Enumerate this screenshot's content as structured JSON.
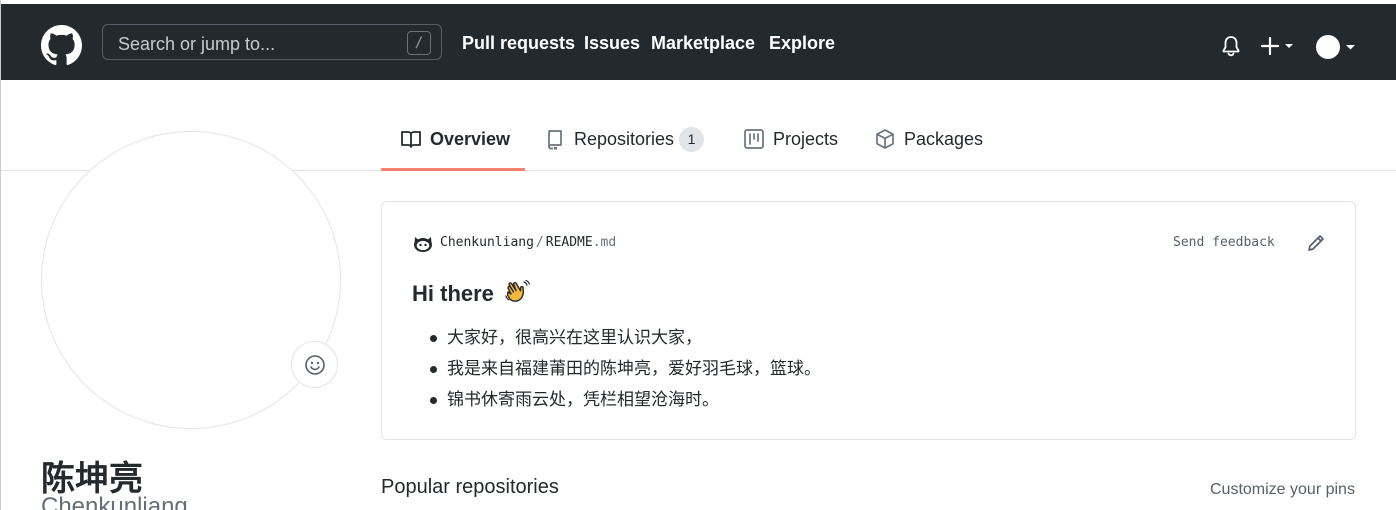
{
  "header": {
    "search_placeholder": "Search or jump to...",
    "search_shortcut": "/",
    "nav": [
      "Pull requests",
      "Issues",
      "Marketplace",
      "Explore"
    ]
  },
  "tabs": {
    "overview": "Overview",
    "repositories": "Repositories",
    "repositories_count": "1",
    "projects": "Projects",
    "packages": "Packages"
  },
  "profile": {
    "name": "陈坤亮",
    "login": "Chenkunliang"
  },
  "readme": {
    "owner": "Chenkunliang",
    "separator": "/",
    "file_base": "README",
    "file_ext": ".md",
    "send_feedback": "Send feedback",
    "title": "Hi there",
    "items": [
      "大家好，很高兴在这里认识大家，",
      "我是来自福建莆田的陈坤亮，爱好羽毛球，篮球。",
      "锦书休寄雨云处，凭栏相望沧海时。"
    ]
  },
  "popular": {
    "title": "Popular repositories",
    "customize": "Customize your pins"
  },
  "colors": {
    "header_bg": "#24292e",
    "tab_underline": "#f9826c",
    "border": "#e1e4e8"
  },
  "icons": {
    "logo": "github-mark-icon",
    "bell": "bell-icon",
    "plus": "plus-icon",
    "book": "book-icon",
    "repo": "repo-icon",
    "project": "project-icon",
    "package": "package-icon",
    "smiley": "smiley-icon",
    "pencil": "pencil-icon",
    "wave": "waving-hand-icon"
  }
}
